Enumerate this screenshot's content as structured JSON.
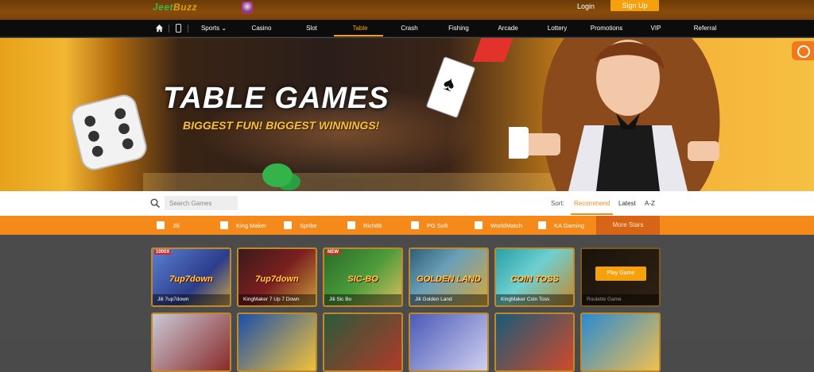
{
  "header": {
    "logo_prefix": "Jeet",
    "logo_suffix": "Buzz",
    "login_label": "Login",
    "signup_label": "Sign Up"
  },
  "nav": {
    "items": [
      {
        "label": "Sports ⌄"
      },
      {
        "label": "Casino"
      },
      {
        "label": "Slot"
      },
      {
        "label": "Table"
      },
      {
        "label": "Crash"
      },
      {
        "label": "Fishing"
      },
      {
        "label": "Arcade"
      },
      {
        "label": "Lottery"
      },
      {
        "label": "Promotions"
      },
      {
        "label": "VIP"
      },
      {
        "label": "Referral"
      }
    ],
    "active": "Table"
  },
  "banner": {
    "title": "TABLE GAMES",
    "subtitle": "BIGGEST FUN! BIGGEST WINNINGS!"
  },
  "search": {
    "placeholder": "Search Games"
  },
  "sort": {
    "label": "Sort:",
    "options": [
      "Recommend",
      "Latest",
      "A-Z"
    ],
    "active": "Recommend"
  },
  "filters": {
    "providers": [
      "Jili",
      "King Maker",
      "Spribe",
      "Rich88",
      "PG Soft",
      "WorldMatch",
      "KA Gaming"
    ],
    "more_label": "More Stars"
  },
  "games": [
    {
      "caption": "Jili 7up7down",
      "tag": "1000X",
      "art_title": "7up7down"
    },
    {
      "caption": "KingMaker 7 Up 7 Down",
      "tag": "",
      "art_title": "7up7down"
    },
    {
      "caption": "Jili Sic Bo",
      "tag": "NEW",
      "art_title": "SIC-BO"
    },
    {
      "caption": "Jili Golden Land",
      "tag": "",
      "art_title": "GOLDEN LAND"
    },
    {
      "caption": "KingMaker Coin Toss",
      "tag": "",
      "art_title": "COIN TOSS"
    },
    {
      "caption": "Roulette Game",
      "tag": "",
      "art_title": ""
    }
  ],
  "hover_play_label": "Play Game",
  "colors": {
    "accent": "#f5a10d",
    "filter_bar": "#f5891a",
    "nav_bg": "#0c0c0c",
    "header_bg": "#7a420a"
  }
}
